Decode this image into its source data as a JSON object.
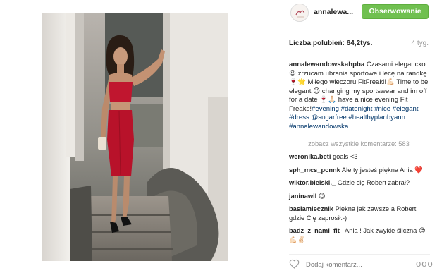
{
  "header": {
    "username": "annalewa...",
    "follow_label": "Obserwowanie"
  },
  "stats": {
    "likes": "Liczba polubień: 64,2tys.",
    "time_ago": "4 tyg."
  },
  "caption": {
    "username": "annalewandowskahpba",
    "line1": " Czasami eleganckо 😉 zrzucam ubrania sportowe i lecę na randkę 🍷🌟 Miłego wieczoru FitFreaki!💪🏻 Time to be elegant 😉 changing my sportswear and im off for a date 🍷🙏🏻 have a nice evening Fit Freaks!",
    "tags": [
      "#evening",
      "#datenight",
      "#nice",
      "#elegant",
      "#dress",
      "@sugarfree",
      "#healthyplanbyann",
      "#annalewandowska"
    ]
  },
  "view_all_comments": "zobacz wszystkie komentarze: 583",
  "comments": [
    {
      "user": "weronika.beti",
      "text": " goals <3"
    },
    {
      "user": "sph_mcs_pcnnk",
      "text": " Ale ty jesteś piękna Ania ❤️"
    },
    {
      "user": "wiktor.bielski._",
      "text": " Gdzie cię Robert zabrał?"
    },
    {
      "user": "janinawil",
      "text": " 😍"
    },
    {
      "user": "basiamiecznik",
      "text": " Piękna jak zawsze a Robert gdzie Cię zaprosił:-)"
    },
    {
      "user": "badz_z_nami_fit_",
      "text": " Ania ! Jak zwykle śliczna 😍💪🏻✌🏻"
    }
  ],
  "footer": {
    "comment_placeholder": "Dodaj komentarz...",
    "more_label": "ooo"
  },
  "icons": {
    "like": "heart-icon",
    "more": "more-options-icon",
    "avatar": "avatar-icon"
  },
  "colors": {
    "follow_button": "#70c050",
    "hashtag": "#003569",
    "muted_text": "#999999",
    "dress": "#c0162f"
  }
}
